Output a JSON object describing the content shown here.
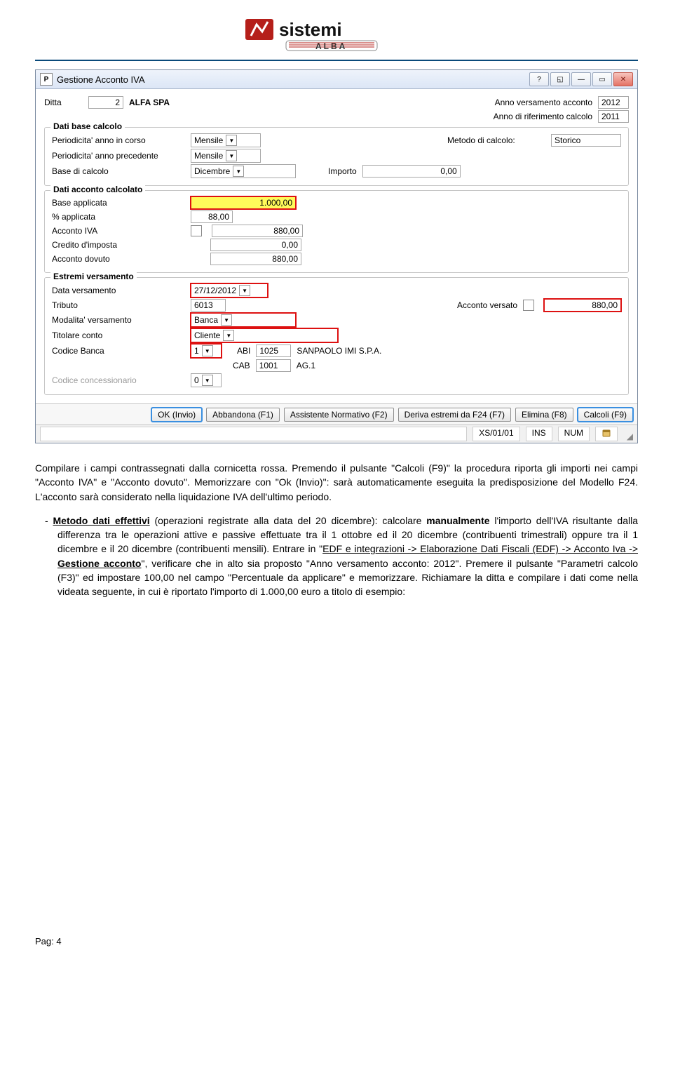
{
  "logo_brand": "sistemi",
  "logo_sub": "ALBA",
  "window": {
    "title": "Gestione Acconto IVA",
    "icon_letter": "P",
    "ditta_label": "Ditta",
    "ditta_code": "2",
    "ditta_name": "ALFA SPA",
    "anno_versamento_label": "Anno versamento acconto",
    "anno_versamento_value": "2012",
    "anno_riferimento_label": "Anno di riferimento calcolo",
    "anno_riferimento_value": "2011",
    "fs_dati_base": {
      "legend": "Dati base calcolo",
      "periodicita_corso_label": "Periodicita' anno in corso",
      "periodicita_corso_value": "Mensile",
      "periodicita_prec_label": "Periodicita' anno precedente",
      "periodicita_prec_value": "Mensile",
      "base_calcolo_label": "Base di calcolo",
      "base_calcolo_value": "Dicembre",
      "metodo_label": "Metodo di calcolo:",
      "metodo_value": "Storico",
      "importo_label": "Importo",
      "importo_value": "0,00"
    },
    "fs_dati_acconto": {
      "legend": "Dati acconto calcolato",
      "base_applicata_label": "Base applicata",
      "base_applicata_value": "1.000,00",
      "pct_applicata_label": "% applicata",
      "pct_applicata_value": "88,00",
      "acconto_iva_label": "Acconto IVA",
      "acconto_iva_value": "880,00",
      "credito_imposta_label": "Credito d'imposta",
      "credito_imposta_value": "0,00",
      "acconto_dovuto_label": "Acconto dovuto",
      "acconto_dovuto_value": "880,00"
    },
    "fs_estremi": {
      "legend": "Estremi versamento",
      "data_versamento_label": "Data versamento",
      "data_versamento_value": "27/12/2012",
      "tributo_label": "Tributo",
      "tributo_value": "6013",
      "acconto_versato_label": "Acconto versato",
      "acconto_versato_value": "880,00",
      "modalita_label": "Modalita' versamento",
      "modalita_value": "Banca",
      "titolare_label": "Titolare conto",
      "titolare_value": "Cliente",
      "codice_banca_label": "Codice Banca",
      "codice_banca_value": "1",
      "abi_label": "ABI",
      "abi_value": "1025",
      "abi_desc": "SANPAOLO IMI S.P.A.",
      "cab_label": "CAB",
      "cab_value": "1001",
      "cab_desc": "AG.1",
      "codice_concess_label": "Codice concessionario",
      "codice_concess_value": "0"
    },
    "buttons": {
      "ok": "OK (Invio)",
      "abbandona": "Abbandona (F1)",
      "assistente": "Assistente Normativo (F2)",
      "deriva": "Deriva estremi da F24 (F7)",
      "elimina": "Elimina (F8)",
      "calcoli": "Calcoli (F9)"
    },
    "status": {
      "ver": "XS/01/01",
      "ins": "INS",
      "num": "NUM"
    }
  },
  "text": {
    "p1": "Compilare i campi contrassegnati dalla cornicetta rossa. Premendo il pulsante \"Calcoli (F9)\" la procedura riporta gli importi nei campi \"Acconto IVA\" e \"Acconto dovuto\". Memorizzare con \"Ok (Invio)\": sarà automaticamente eseguita la predisposizione del Modello F24. L'acconto sarà considerato nella liquidazione IVA dell'ultimo periodo.",
    "li1a": "Metodo dati effettivi",
    "li1b": " (operazioni registrate alla data del 20 dicembre): calcolare ",
    "li1c": "manualmente",
    "li1d": " l'importo dell'IVA risultante dalla differenza tra le operazioni attive e passive effettuate tra il 1 ottobre ed il 20 dicembre (contribuenti trimestrali) oppure tra il 1 dicembre e il 20 dicembre (contribuenti mensili). Entrare in \"",
    "li1e": "EDF e integrazioni -> Elaborazione Dati Fiscali (EDF) -> Acconto Iva -> ",
    "li1f": "Gestione acconto",
    "li1g": "\", verificare che in alto sia proposto \"Anno versamento acconto: 2012\". Premere il pulsante \"Parametri calcolo (F3)\" ed impostare 100,00 nel campo \"Percentuale da applicare\" e memorizzare. Richiamare la ditta e compilare i dati come nella videata seguente, in cui è riportato l'importo di 1.000,00 euro a titolo di esempio:"
  },
  "footer": "Pag: 4"
}
